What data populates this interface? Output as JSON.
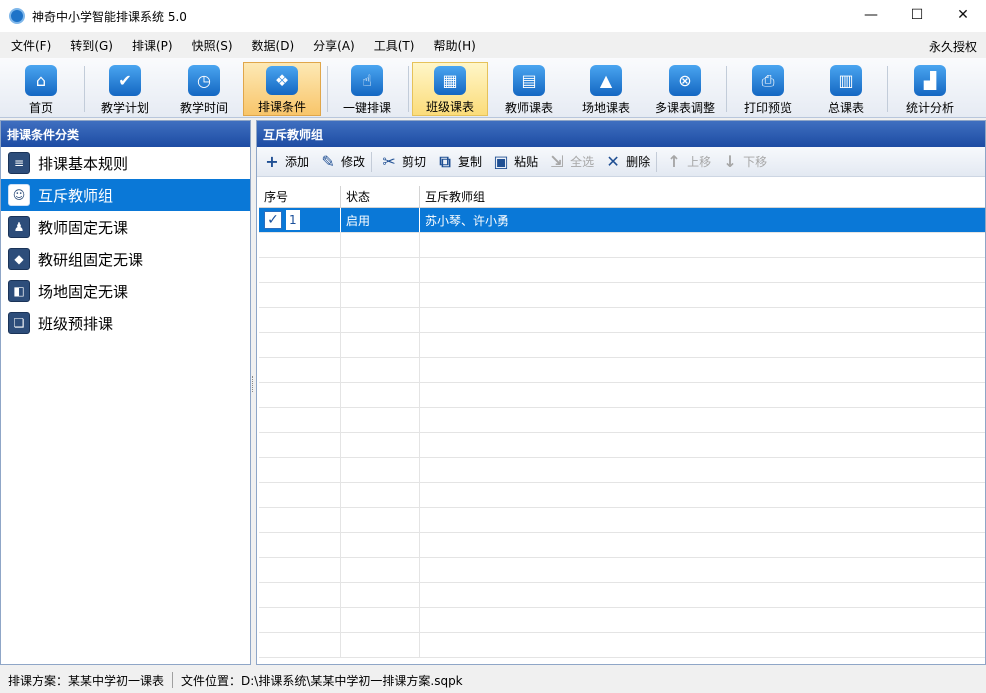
{
  "window": {
    "title": "神奇中小学智能排课系统 5.0",
    "minimize": "—",
    "maximize": "☐",
    "close": "✕"
  },
  "menu": {
    "items": [
      "文件(F)",
      "转到(G)",
      "排课(P)",
      "快照(S)",
      "数据(D)",
      "分享(A)",
      "工具(T)",
      "帮助(H)"
    ],
    "license": "永久授权"
  },
  "toolbar": {
    "items": [
      {
        "label": "首页",
        "icon": "home-icon"
      },
      {
        "label": "教学计划",
        "icon": "clipboard-check-icon"
      },
      {
        "label": "教学时间",
        "icon": "clock-icon"
      },
      {
        "label": "排课条件",
        "icon": "cubes-icon",
        "state": "active"
      },
      {
        "label": "一键排课",
        "icon": "hand-click-icon"
      },
      {
        "label": "班级课表",
        "icon": "calendar-grid-icon",
        "state": "highlight"
      },
      {
        "label": "教师课表",
        "icon": "teacher-schedule-icon"
      },
      {
        "label": "场地课表",
        "icon": "building-icon"
      },
      {
        "label": "多课表调整",
        "icon": "multi-schedule-icon"
      },
      {
        "label": "打印预览",
        "icon": "printer-icon"
      },
      {
        "label": "总课表",
        "icon": "master-schedule-icon"
      },
      {
        "label": "统计分析",
        "icon": "chart-icon"
      }
    ]
  },
  "left_panel": {
    "title": "排课条件分类",
    "items": [
      {
        "label": "排课基本规则",
        "icon": "rules-icon"
      },
      {
        "label": "互斥教师组",
        "icon": "teacher-group-icon",
        "selected": true
      },
      {
        "label": "教师固定无课",
        "icon": "teacher-icon"
      },
      {
        "label": "教研组固定无课",
        "icon": "cube-icon"
      },
      {
        "label": "场地固定无课",
        "icon": "layout-icon"
      },
      {
        "label": "班级预排课",
        "icon": "book-icon"
      }
    ]
  },
  "right_panel": {
    "title": "互斥教师组",
    "actions": [
      {
        "label": "添加",
        "icon": "plus-icon",
        "glyph": "+",
        "enabled": true
      },
      {
        "label": "修改",
        "icon": "pencil-icon",
        "glyph": "✎",
        "enabled": true
      },
      {
        "label": "剪切",
        "icon": "scissors-icon",
        "glyph": "✂",
        "enabled": true
      },
      {
        "label": "复制",
        "icon": "copy-icon",
        "glyph": "⧉",
        "enabled": true
      },
      {
        "label": "粘贴",
        "icon": "paste-icon",
        "glyph": "▣",
        "enabled": true
      },
      {
        "label": "全选",
        "icon": "select-all-icon",
        "glyph": "⇲",
        "enabled": false
      },
      {
        "label": "删除",
        "icon": "delete-icon",
        "glyph": "✕",
        "enabled": true
      },
      {
        "label": "上移",
        "icon": "arrow-up-icon",
        "glyph": "↑",
        "enabled": false
      },
      {
        "label": "下移",
        "icon": "arrow-down-icon",
        "glyph": "↓",
        "enabled": false
      }
    ],
    "table": {
      "columns": [
        "序号",
        "状态",
        "互斥教师组"
      ],
      "rows": [
        {
          "seq": "1",
          "status": "启用",
          "group": "苏小琴、许小勇",
          "checked": true
        }
      ]
    }
  },
  "statusbar": {
    "plan": "排课方案：某某中学初一课表",
    "location": "文件位置：D:\\排课系统\\某某中学初一排课方案.sqpk"
  },
  "colors": {
    "selection": "#0a78d7",
    "header_blue": "#1d4ca3",
    "active_tab": "#f8c56a"
  }
}
